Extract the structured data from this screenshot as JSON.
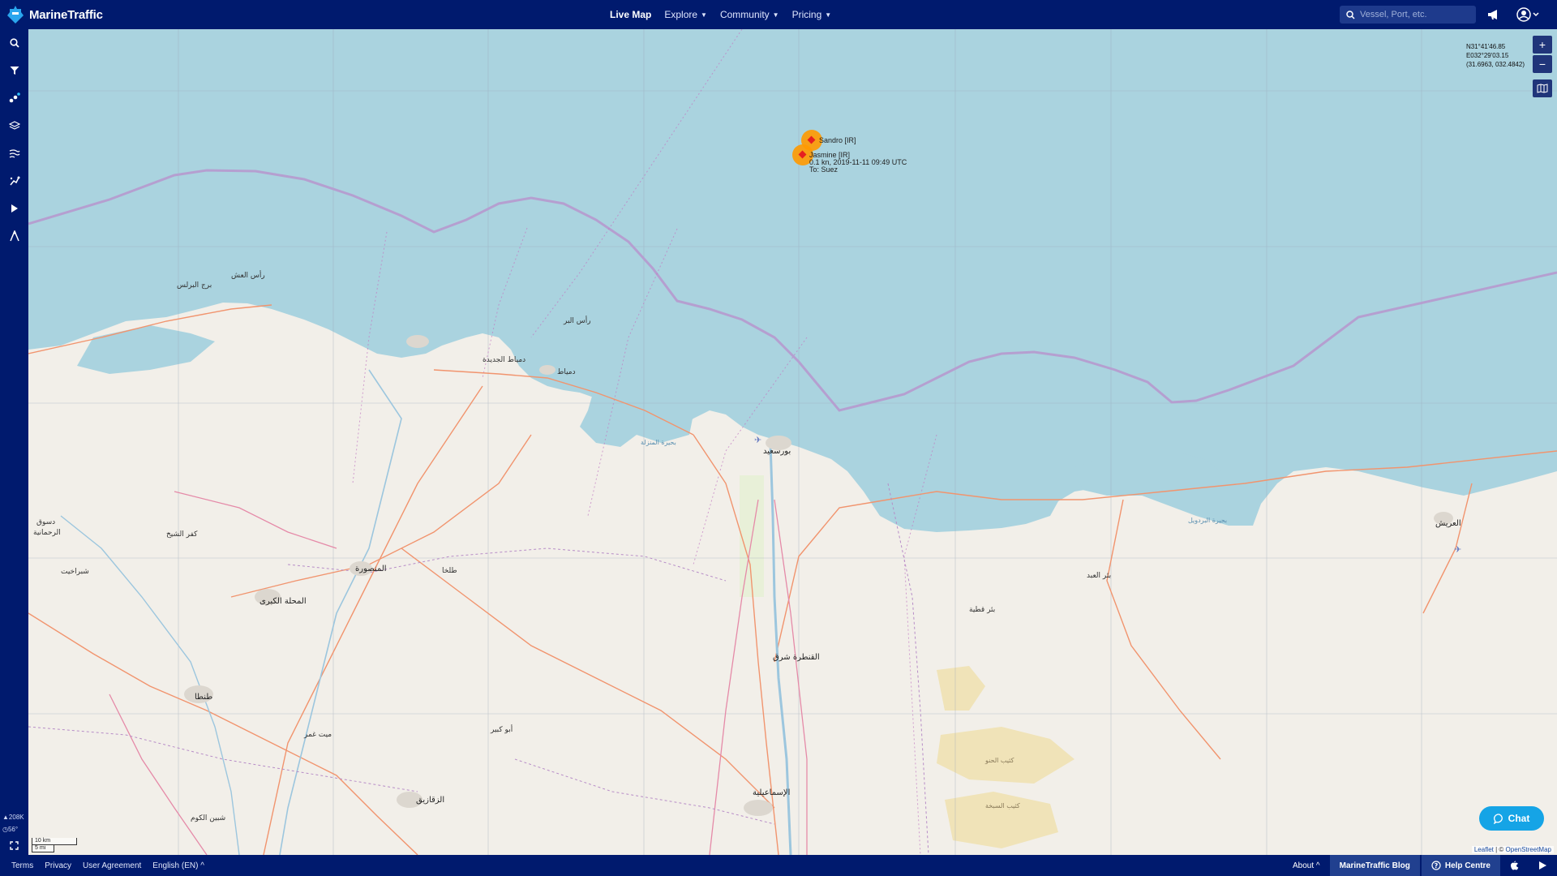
{
  "header": {
    "brand": "MarineTraffic",
    "nav": [
      {
        "label": "Live Map",
        "active": true,
        "dropdown": false
      },
      {
        "label": "Explore",
        "active": false,
        "dropdown": true
      },
      {
        "label": "Community",
        "active": false,
        "dropdown": true
      },
      {
        "label": "Pricing",
        "active": false,
        "dropdown": true
      }
    ],
    "search_placeholder": "Vessel, Port, etc.",
    "icons": [
      "megaphone-icon",
      "user-account-icon"
    ]
  },
  "sidebar": {
    "tools": [
      "search-icon",
      "filter-icon",
      "my-fleets-icon",
      "layers-icon",
      "weather-icon",
      "density-icon",
      "playback-icon",
      "measure-icon"
    ],
    "stats": {
      "vessels": "208K",
      "zoom": "56°"
    }
  },
  "map": {
    "coordinates": [
      "N31°41'46.85",
      "E032°29'03.15",
      "(31.6963, 032.4842)"
    ],
    "zoom_in": "+",
    "zoom_out": "−",
    "vessels": [
      {
        "name": "Sandro [IR]"
      },
      {
        "name": "Jasmine [IR]",
        "speed_line": "0.1 kn, 2019-11-11 09:49 UTC",
        "destination": "To: Suez"
      }
    ],
    "places": {
      "port_said": "بورسعيد",
      "damietta": "دمياط",
      "new_damietta": "دمياط الجديدة",
      "mansoura": "المنصورة",
      "mahalla": "المحلة الكبرى",
      "tanta": "طنطا",
      "zagazig": "الزقازيق",
      "ismailia": "الإسماعيلية",
      "qantara": "القنطرة شرق",
      "arish": "العريش",
      "burullus": "برج البرلس",
      "desouk": "دسوق",
      "talkha": "طلخا",
      "abu_kebir": "أبو كبير",
      "bir_el_abd": "بئر العبد",
      "bir_qatia": "بئر قطية",
      "manzala": "بحيرة المنزلة",
      "bardawil": "بحيرة البردويل",
      "ras_el_bar": "رأس البر",
      "sinbillawin": "شبين الكوم",
      "khattara": "كثيب الحنو",
      "ka_sabkha": "كثيب السبخة",
      "kafr_sheikh": "كفر الشيخ",
      "rahmaniya": "الرحمانية",
      "shubra": "شبراخيت",
      "mit_ghamr": "ميت غمر",
      "ras_el_oush": "رأس العش"
    },
    "scale": {
      "km": "10 km",
      "mi": "5 mi"
    },
    "attribution": {
      "leaflet": "Leaflet",
      "sep": " | © ",
      "osm": "OpenStreetMap"
    },
    "chat_label": "Chat"
  },
  "footer": {
    "links": [
      "Terms",
      "Privacy",
      "User Agreement",
      "English (EN)"
    ],
    "about": "About",
    "blog": "MarineTraffic Blog",
    "help": "Help Centre"
  },
  "colors": {
    "navy": "#001a6e",
    "sea": "#aad3df",
    "land": "#f2efe9",
    "eez": "#b59fd0",
    "vessel": "#ff9900",
    "chat": "#15a4e6"
  }
}
